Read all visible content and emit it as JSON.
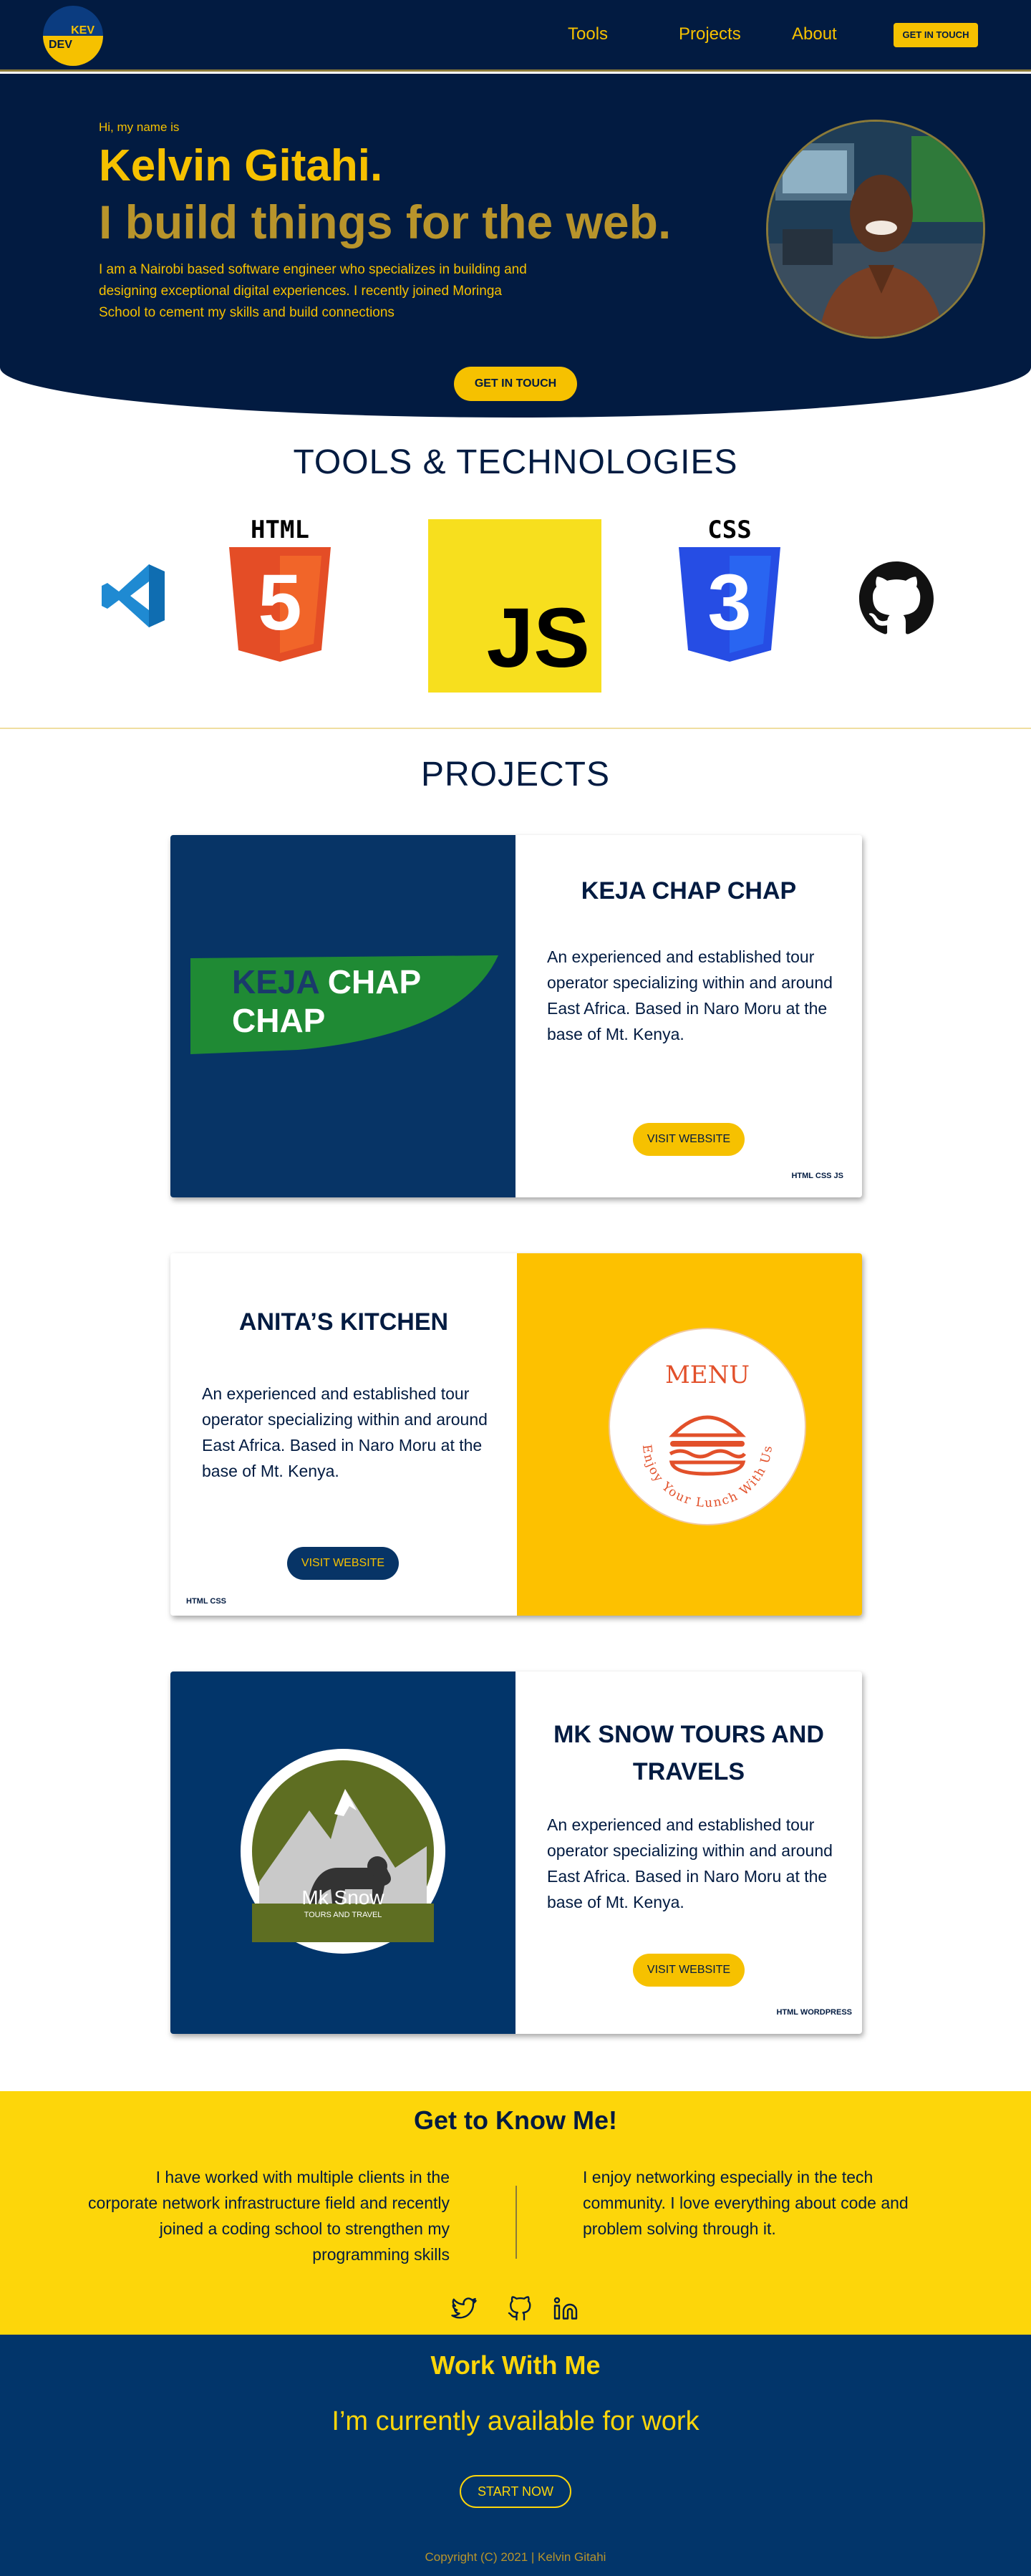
{
  "nav": {
    "logo_top": "KEV",
    "logo_bottom": "DEV",
    "links": [
      "Tools",
      "Projects",
      "About"
    ],
    "cta": "GET IN TOUCH"
  },
  "hero": {
    "intro": "Hi, my name is",
    "name": "Kelvin Gitahi.",
    "tagline": "I build things for the web.",
    "description": "I am a Nairobi based software engineer who specializes in building and designing exceptional digital experiences. I recently joined Moringa School to cement my skills and build connections",
    "cta": "GET IN TOUCH"
  },
  "tools": {
    "title": "TOOLS & TECHNOLOGIES",
    "items": [
      {
        "icon": "vscode-icon"
      },
      {
        "icon": "html5-icon",
        "label": "HTML",
        "glyph": "5"
      },
      {
        "icon": "javascript-icon",
        "label": "JS"
      },
      {
        "icon": "css3-icon",
        "label": "CSS",
        "glyph": "3"
      },
      {
        "icon": "github-icon"
      }
    ]
  },
  "projects": {
    "title": "PROJECTS",
    "items": [
      {
        "title": "KEJA CHAP CHAP",
        "logo_word1": "KEJA",
        "logo_word2": "CHAP",
        "logo_word3": "CHAP",
        "description": "An experienced and established tour operator specializing within and around East Africa. Based in Naro Moru at the base of Mt. Kenya.",
        "button": "VISIT WEBSITE",
        "tags": "HTML CSS JS"
      },
      {
        "title": "ANITA’S KITCHEN",
        "logo_word": "MENU",
        "logo_arc": "Enjoy Your Lunch With Us",
        "description": "An experienced and established tour operator specializing within and around East Africa. Based in Naro Moru at the base of Mt. Kenya.",
        "button": "VISIT WEBSITE",
        "tags": "HTML CSS"
      },
      {
        "title": "MK SNOW TOURS AND TRAVELS",
        "logo_name": "Mk Snow",
        "logo_sub": "TOURS AND TRAVEL",
        "description": "An experienced and established tour operator specializing within and around East Africa. Based in Naro Moru at the base of Mt. Kenya.",
        "button": "VISIT WEBSITE",
        "tags": "HTML WORDPRESS"
      }
    ]
  },
  "about": {
    "title": "Get to Know Me!",
    "left": "I have worked with multiple clients in the corporate network infrastructure field and recently joined a coding school to strengthen my programming skills",
    "right": "I enjoy networking especially in the tech community. I love everything about code and problem solving through it.",
    "socials": [
      "twitter-icon",
      "github-icon",
      "linkedin-icon"
    ]
  },
  "work": {
    "title": "Work With Me",
    "subtitle": "I’m currently available for work",
    "cta": "START NOW",
    "copyright": "Copyright (C) 2021 | Kelvin Gitahi"
  },
  "colors": {
    "navy": "#021b41",
    "gold": "#f6c100",
    "yellow": "#fdd60a",
    "card_blue": "#073466",
    "card_yellow": "#fdc100",
    "mk_blue": "#02356a"
  }
}
